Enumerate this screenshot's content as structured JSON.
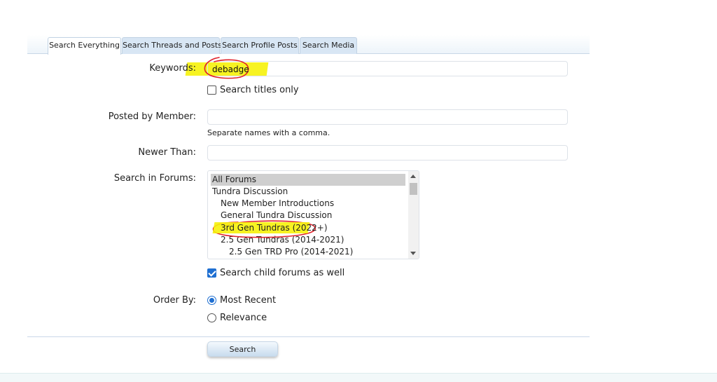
{
  "tabs": [
    {
      "label": "Search Everything",
      "active": true
    },
    {
      "label": "Search Threads and Posts",
      "active": false
    },
    {
      "label": "Search Profile Posts",
      "active": false
    },
    {
      "label": "Search Media",
      "active": false
    }
  ],
  "keywords": {
    "label": "Keywords:",
    "value": "debadge"
  },
  "titles_only": {
    "label": "Search titles only",
    "checked": false
  },
  "member": {
    "label": "Posted by Member:",
    "value": "",
    "hint": "Separate names with a comma."
  },
  "newer_than": {
    "label": "Newer Than:",
    "value": ""
  },
  "forums": {
    "label": "Search in Forums:",
    "options": [
      {
        "label": "All Forums",
        "selected": true,
        "level": 0
      },
      {
        "label": "Tundra Discussion",
        "selected": false,
        "level": 0
      },
      {
        "label": "New Member Introductions",
        "selected": false,
        "level": 1
      },
      {
        "label": "General Tundra Discussion",
        "selected": false,
        "level": 1
      },
      {
        "label": "3rd Gen Tundras (2022+)",
        "selected": false,
        "level": 1
      },
      {
        "label": "2.5 Gen Tundras (2014-2021)",
        "selected": false,
        "level": 1
      },
      {
        "label": "2.5 Gen TRD Pro (2014-2021)",
        "selected": false,
        "level": 2
      }
    ]
  },
  "child_forums": {
    "label": "Search child forums as well",
    "checked": true
  },
  "order_by": {
    "label": "Order By:",
    "options": [
      {
        "label": "Most Recent",
        "selected": true
      },
      {
        "label": "Relevance",
        "selected": false
      }
    ]
  },
  "search_button": "Search",
  "colors": {
    "highlight": "#f6f20a",
    "annotation_red": "#e0202a",
    "accent": "#1f6fd1"
  }
}
